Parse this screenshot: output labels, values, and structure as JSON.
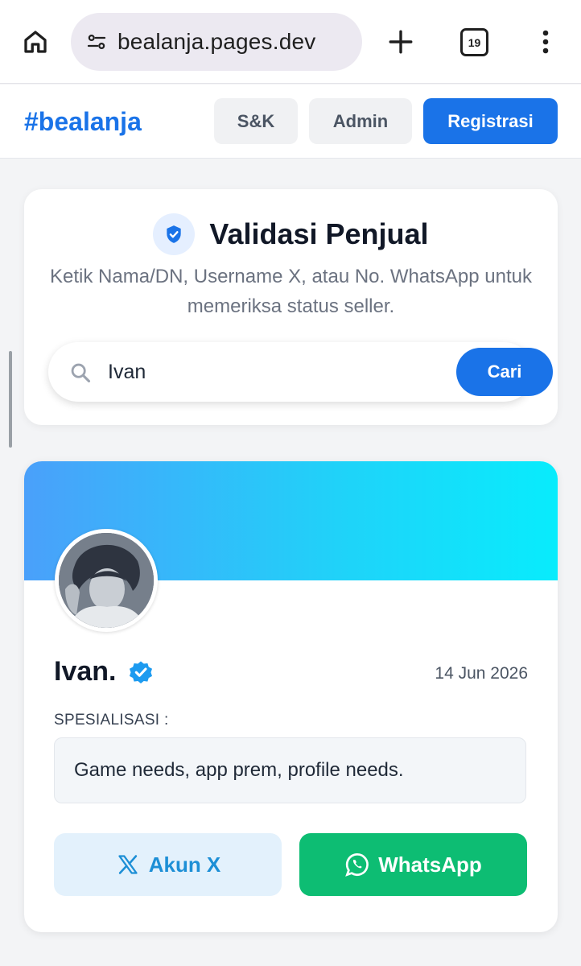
{
  "browser": {
    "url": "bealanja.pages.dev",
    "tab_count": "19",
    "icons": [
      "home-icon",
      "site-settings-icon",
      "new-tab-plus-icon",
      "tab-switcher-icon",
      "more-vert-icon"
    ]
  },
  "header": {
    "brand": "#bealanja",
    "nav": {
      "sk": "S&K",
      "admin": "Admin",
      "register": "Registrasi"
    }
  },
  "search_card": {
    "title": "Validasi Penjual",
    "description": "Ketik Nama/DN, Username X, atau No. WhatsApp untuk memeriksa status seller.",
    "query": "Ivan",
    "button": "Cari"
  },
  "profile": {
    "name": "Ivan.",
    "date": "14 Jun 2026",
    "spec_label": "SPESIALISASI :",
    "specialization": "Game needs, app prem, profile needs.",
    "x_button": "Akun X",
    "wa_button": "WhatsApp"
  },
  "colors": {
    "accent": "#1a73e8",
    "whatsapp": "#0dbd73",
    "x_button_bg": "#e3f1fc",
    "banner_start": "#4aa0fa",
    "banner_end": "#08ecfc"
  }
}
